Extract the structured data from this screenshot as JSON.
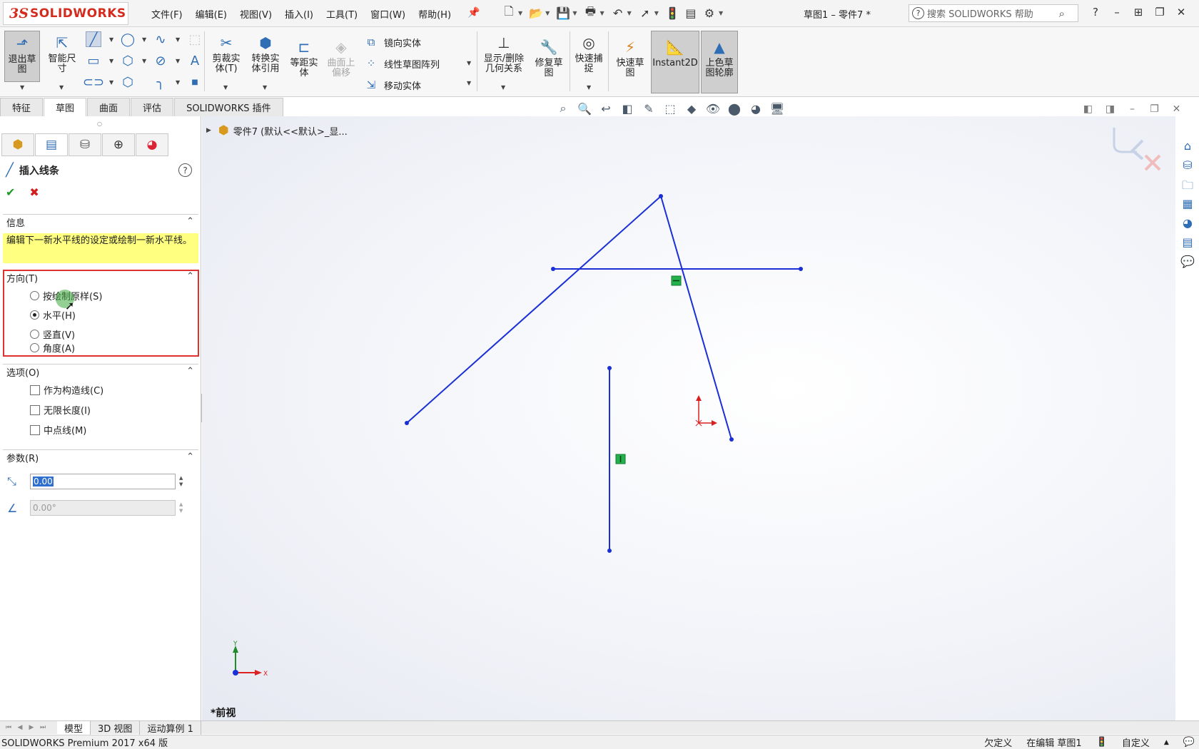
{
  "app": {
    "logo_ds": "3S",
    "logo_name": "SOLIDWORKS",
    "document_title": "草图1 – 零件7 *"
  },
  "menu": [
    "文件(F)",
    "编辑(E)",
    "视图(V)",
    "插入(I)",
    "工具(T)",
    "窗口(W)",
    "帮助(H)"
  ],
  "search": {
    "placeholder": "搜索 SOLIDWORKS 帮助"
  },
  "ribbon": {
    "exit_sketch": "退出草图",
    "smart_dimension": "智能尺寸",
    "trim": "剪裁实体(T)",
    "convert": "转换实体引用",
    "offset": "等距实体",
    "offset_on_surface": "曲面上偏移",
    "mirror": "镜向实体",
    "linear_pattern": "线性草图阵列",
    "move": "移动实体",
    "show_relations": "显示/删除几何关系",
    "repair": "修复草图",
    "quick_snap": "快速捕捉",
    "rapid_sketch": "快速草图",
    "instant2d": "Instant2D",
    "shaded_contours": "上色草图轮廓"
  },
  "tabs": [
    "特征",
    "草图",
    "曲面",
    "评估",
    "SOLIDWORKS 插件"
  ],
  "panel": {
    "title": "插入线条",
    "info_header": "信息",
    "info_text": "编辑下一新水平线的设定或绘制一新水平线。",
    "orientation_header": "方向(T)",
    "orientation_options": [
      {
        "label": "按绘制原样(S)",
        "selected": false
      },
      {
        "label": "水平(H)",
        "selected": true
      },
      {
        "label": "竖直(V)",
        "selected": false
      },
      {
        "label": "角度(A)",
        "selected": false
      }
    ],
    "options_header": "选项(O)",
    "options": [
      "作为构造线(C)",
      "无限长度(I)",
      "中点线(M)"
    ],
    "params_header": "参数(R)",
    "length_value": "0.00",
    "angle_value": "0.00°"
  },
  "viewport": {
    "tree_label": "零件7  (默认<<默认>_显...",
    "view_name": "*前视",
    "axis_x": "X",
    "axis_y": "Y"
  },
  "bottom_tabs": [
    "模型",
    "3D 视图",
    "运动算例 1"
  ],
  "status": {
    "product": "SOLIDWORKS Premium 2017 x64 版",
    "defined": "欠定义",
    "editing": "在编辑 草图1",
    "custom": "自定义"
  },
  "colors": {
    "sketch_line": "#1a2fd6",
    "relation_marker": "#22b24c",
    "highlight_box": "#e03030",
    "info_bg": "#ffff80"
  }
}
